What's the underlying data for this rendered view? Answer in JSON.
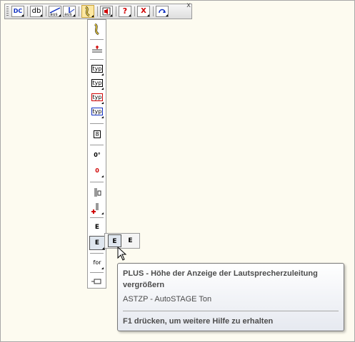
{
  "toolbar": {
    "buttons": [
      {
        "id": "dc",
        "label": "DC",
        "icon": "dc-icon"
      },
      {
        "id": "db",
        "label": "db",
        "icon": "db-icon"
      },
      {
        "id": "aus1",
        "label": "aus",
        "icon": "aus-line-icon"
      },
      {
        "id": "aus2",
        "label": "aus",
        "icon": "aus-angle-icon"
      },
      {
        "id": "speaker-cable",
        "label": "",
        "icon": "speaker-cable-icon"
      },
      {
        "id": "speaker",
        "label": "",
        "icon": "speaker-icon"
      },
      {
        "id": "help",
        "label": "?",
        "icon": "help-icon"
      },
      {
        "id": "delete",
        "label": "X",
        "icon": "delete-icon"
      },
      {
        "id": "refresh",
        "label": "",
        "icon": "refresh-icon"
      }
    ],
    "close": "x"
  },
  "flyout": {
    "items": [
      {
        "label": "",
        "icon": "speaker-cable-icon"
      },
      {
        "label": "",
        "icon": "split-line-icon"
      },
      {
        "label": "typ",
        "icon": "typ-icon"
      },
      {
        "label": "typ",
        "icon": "typ-add-icon"
      },
      {
        "label": "typ",
        "icon": "typ-add-red-icon"
      },
      {
        "label": "typ",
        "icon": "typ-add-blue-icon"
      },
      {
        "label": "8",
        "icon": "copy-icon"
      },
      {
        "label": "0°",
        "icon": "angle-zero-icon"
      },
      {
        "label": "0",
        "icon": "angle-plus-icon"
      },
      {
        "label": "",
        "icon": "bar-small-icon"
      },
      {
        "label": "",
        "icon": "bar-plus-icon"
      },
      {
        "label": "E",
        "icon": "bar-e-icon"
      },
      {
        "label": "E",
        "icon": "bar-e-plus-icon"
      },
      {
        "label": "for",
        "icon": "for-icon"
      },
      {
        "label": "",
        "icon": "connector-icon"
      }
    ]
  },
  "subflyout": {
    "items": [
      {
        "label": "E",
        "icon": "bar-e-plus-icon"
      },
      {
        "label": "E",
        "icon": "bar-e-minus-icon"
      }
    ]
  },
  "tooltip": {
    "title": "PLUS - Höhe der Anzeige der Lautsprecherzuleitung vergrößern",
    "command": "ASTZP - AutoSTAGE Ton",
    "help": "F1 drücken, um weitere Hilfe zu erhalten"
  },
  "colors": {
    "background": "#fdfbf0",
    "accent_red": "#d00000",
    "accent_blue": "#1030c0",
    "active_highlight": "#fde7a0"
  }
}
